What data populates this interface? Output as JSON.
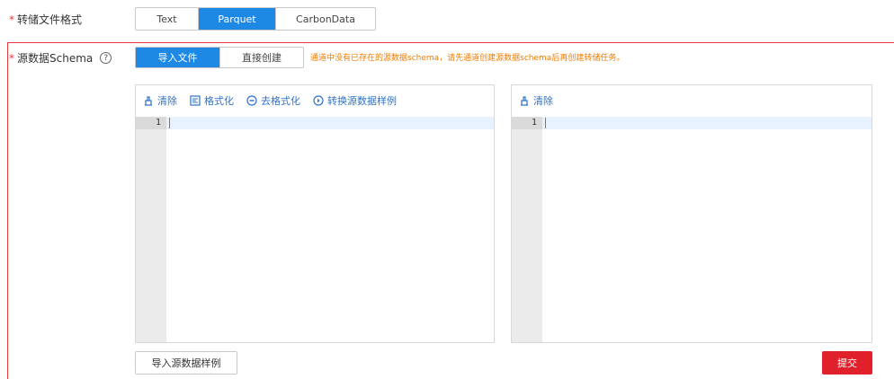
{
  "format_row": {
    "label": "转储文件格式",
    "options": [
      "Text",
      "Parquet",
      "CarbonData"
    ],
    "selected": "Parquet"
  },
  "schema_row": {
    "label": "源数据Schema",
    "help_icon": "question-circle-icon",
    "tabs": [
      "导入文件",
      "直接创建"
    ],
    "selected_tab": "导入文件",
    "hint": "通道中没有已存在的源数据schema，请先通道创建源数据schema后再创建转储任务。"
  },
  "left_editor": {
    "toolbar": [
      {
        "icon": "clear-icon",
        "label": "清除"
      },
      {
        "icon": "format-icon",
        "label": "格式化"
      },
      {
        "icon": "unformat-icon",
        "label": "去格式化"
      },
      {
        "icon": "convert-icon",
        "label": "转换源数据样例"
      }
    ],
    "line_number": "1"
  },
  "right_editor": {
    "toolbar": [
      {
        "icon": "clear-icon",
        "label": "清除"
      }
    ],
    "line_number": "1"
  },
  "import_sample_button": "导入源数据样例",
  "submit_button": "提交",
  "colors": {
    "accent": "#1e88e5",
    "required": "#e4393c",
    "hint": "#f07c00",
    "submit": "#e0202a"
  }
}
